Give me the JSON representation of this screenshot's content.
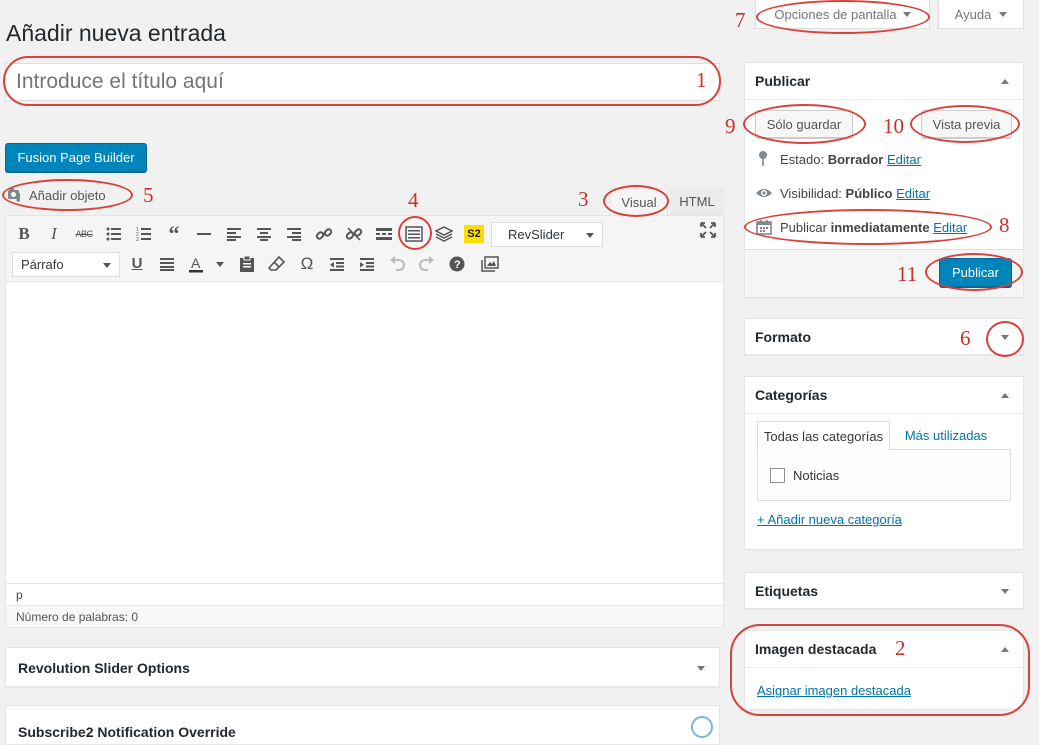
{
  "screen_options": {
    "label": "Opciones de pantalla",
    "help": "Ayuda"
  },
  "page_title": "Añadir nueva entrada",
  "title_input": {
    "placeholder": "Introduce el título aquí"
  },
  "fusion_button": "Fusion Page Builder",
  "add_media": "Añadir objeto",
  "editor_tabs": {
    "visual": "Visual",
    "html": "HTML"
  },
  "toolbar": {
    "revslider": "RevSlider",
    "paragraph": "Párrafo",
    "s2": "S2"
  },
  "editor": {
    "path": "p",
    "word_count": "Número de palabras: 0"
  },
  "postboxes": {
    "revolution": "Revolution Slider Options",
    "subscribe": "Subscribe2 Notification Override"
  },
  "publish": {
    "title": "Publicar",
    "save": "Sólo guardar",
    "preview": "Vista previa",
    "status_label": "Estado:",
    "status_value": "Borrador",
    "visibility_label": "Visibilidad:",
    "visibility_value": "Público",
    "schedule_label": "Publicar",
    "schedule_value": "inmediatamente",
    "edit": "Editar",
    "publish_button": "Publicar"
  },
  "format": {
    "title": "Formato"
  },
  "categories": {
    "title": "Categorías",
    "tab_all": "Todas las categorías",
    "tab_popular": "Más utilizadas",
    "items": [
      "Noticias"
    ],
    "add_new": "+ Añadir nueva categoría"
  },
  "tags": {
    "title": "Etiquetas"
  },
  "featured": {
    "title": "Imagen destacada",
    "link": "Asignar imagen destacada"
  },
  "annotations": [
    "1",
    "2",
    "3",
    "4",
    "5",
    "6",
    "7",
    "8",
    "9",
    "10",
    "11"
  ],
  "colors": {
    "primary": "#0085ba",
    "annotation": "#d9413b",
    "link": "#0073aa"
  }
}
